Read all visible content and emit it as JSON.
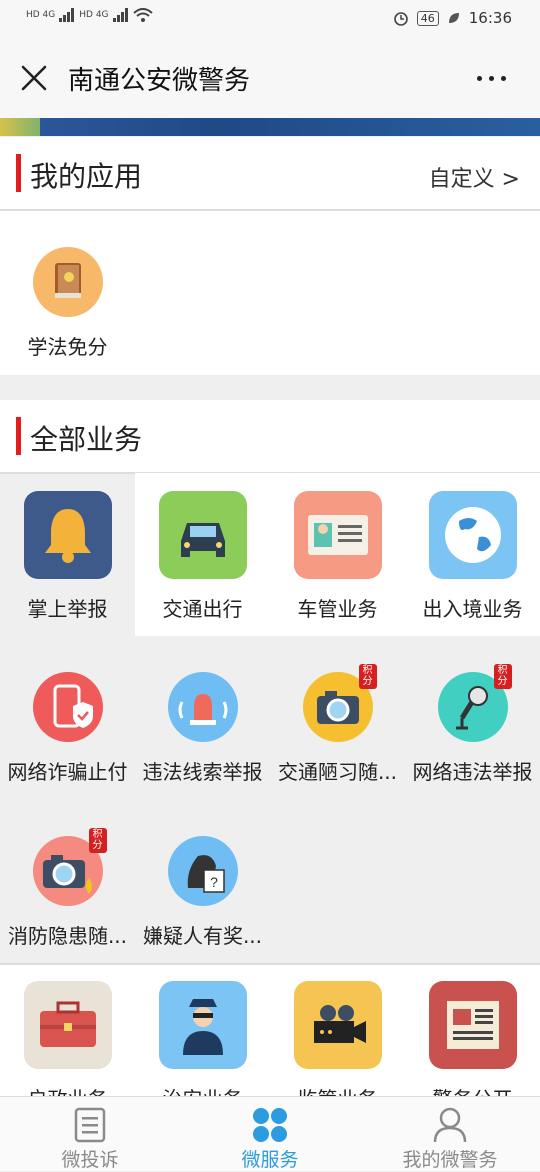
{
  "status_bar": {
    "network_left": "HD 4G",
    "network_right": "HD 4G",
    "battery": "46",
    "time": "16:36"
  },
  "header": {
    "title": "南通公安微警务"
  },
  "my_apps": {
    "title": "我的应用",
    "customize_label": "自定义 >",
    "items": [
      {
        "label": "学法免分",
        "icon": "law-book-icon"
      }
    ]
  },
  "all_services": {
    "title": "全部业务",
    "row1": [
      {
        "label": "掌上举报",
        "icon": "bell-icon"
      },
      {
        "label": "交通出行",
        "icon": "car-icon"
      },
      {
        "label": "车管业务",
        "icon": "id-card-icon"
      },
      {
        "label": "出入境业务",
        "icon": "globe-icon"
      }
    ],
    "row2": [
      {
        "label": "网络诈骗止付",
        "icon": "phone-shield-icon"
      },
      {
        "label": "违法线索举报",
        "icon": "alarm-icon"
      },
      {
        "label": "交通陋习随...",
        "icon": "camera-icon",
        "badge": "积分"
      },
      {
        "label": "网络违法举报",
        "icon": "microphone-icon",
        "badge": "积分"
      }
    ],
    "row3": [
      {
        "label": "消防隐患随...",
        "icon": "fire-camera-icon",
        "badge": "积分"
      },
      {
        "label": "嫌疑人有奖...",
        "icon": "suspect-icon"
      }
    ],
    "row4": [
      {
        "label": "户政业务",
        "icon": "briefcase-icon"
      },
      {
        "label": "治安业务",
        "icon": "police-officer-icon"
      },
      {
        "label": "监管业务",
        "icon": "video-camera-icon"
      },
      {
        "label": "警务公开",
        "icon": "newspaper-icon"
      }
    ]
  },
  "tabbar": {
    "tabs": [
      {
        "label": "微投诉",
        "icon": "complaint-icon"
      },
      {
        "label": "微服务",
        "icon": "services-icon",
        "active": true
      },
      {
        "label": "我的微警务",
        "icon": "user-icon"
      }
    ]
  },
  "colors": {
    "accent_red": "#e21d1d",
    "active_blue": "#2c9be0"
  }
}
